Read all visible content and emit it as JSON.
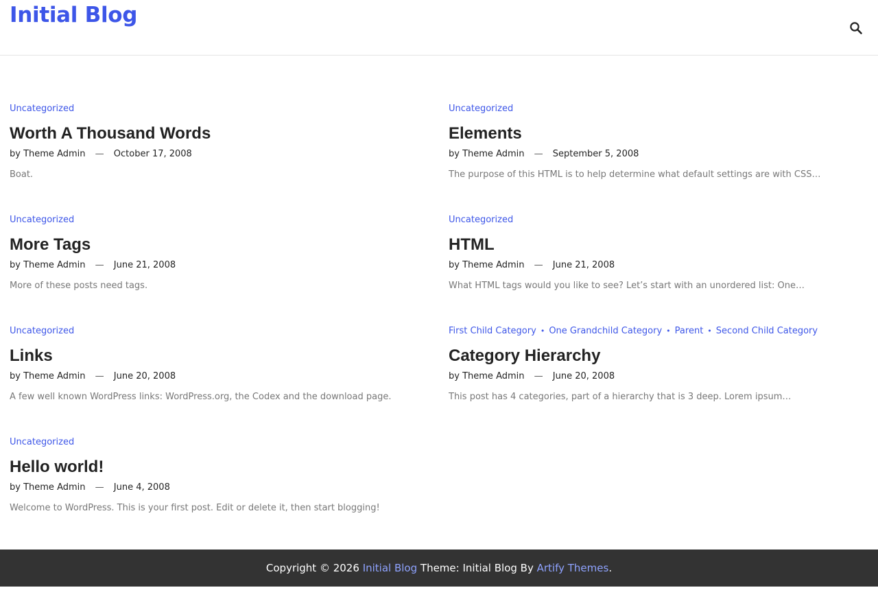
{
  "site": {
    "title": "Initial Blog"
  },
  "header": {
    "search_icon": "search-icon"
  },
  "posts": [
    {
      "categories": [
        "Uncategorized"
      ],
      "title": "Worth A Thousand Words",
      "by": "by",
      "author": "Theme Admin",
      "date": "October 17, 2008",
      "excerpt": "Boat."
    },
    {
      "categories": [
        "Uncategorized"
      ],
      "title": "Elements",
      "by": "by",
      "author": "Theme Admin",
      "date": "September 5, 2008",
      "excerpt": "The purpose of this HTML is to help determine what default settings are with CSS…"
    },
    {
      "categories": [
        "Uncategorized"
      ],
      "title": "More Tags",
      "by": "by",
      "author": "Theme Admin",
      "date": "June 21, 2008",
      "excerpt": "More of these posts need tags."
    },
    {
      "categories": [
        "Uncategorized"
      ],
      "title": "HTML",
      "by": "by",
      "author": "Theme Admin",
      "date": "June 21, 2008",
      "excerpt": "What HTML tags would you like to see? Let’s start with an unordered list: One…"
    },
    {
      "categories": [
        "Uncategorized"
      ],
      "title": "Links",
      "by": "by",
      "author": "Theme Admin",
      "date": "June 20, 2008",
      "excerpt": "A few well known WordPress links: WordPress.org, the Codex and the download page."
    },
    {
      "categories": [
        "First Child Category",
        "One Grandchild Category",
        "Parent",
        "Second Child Category"
      ],
      "title": "Category Hierarchy",
      "by": "by",
      "author": "Theme Admin",
      "date": "June 20, 2008",
      "excerpt": "This post has 4 categories, part of a hierarchy that is 3 deep. Lorem ipsum…"
    },
    {
      "categories": [
        "Uncategorized"
      ],
      "title": "Hello world!",
      "by": "by",
      "author": "Theme Admin",
      "date": "June 4, 2008",
      "excerpt": "Welcome to WordPress. This is your first post. Edit or delete it, then start blogging!"
    }
  ],
  "footer": {
    "copyright": "Copyright © 2026",
    "site_link": "Initial Blog",
    "theme_text": "Theme: Initial Blog By",
    "author_link": "Artify Themes",
    "period": "."
  },
  "colors": {
    "accent": "#3d56e8",
    "footer_bg": "#333333",
    "footer_link": "#8fa3ff"
  }
}
